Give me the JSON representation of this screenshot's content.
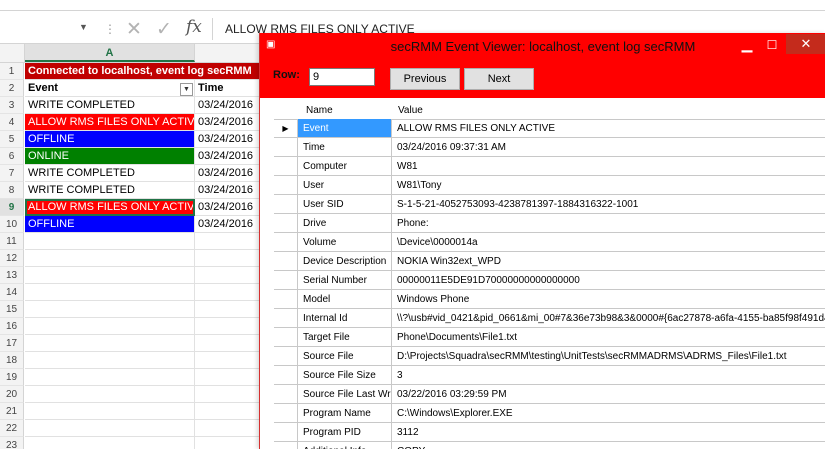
{
  "formula_bar": {
    "value": "ALLOW RMS FILES ONLY ACTIVE",
    "fx": "fx",
    "cancel_glyph": "✕",
    "enter_glyph": "✓"
  },
  "sheet": {
    "column_a": "A",
    "rows": [
      {
        "num": "1",
        "a": "Connected to localhost, event log secRMM",
        "b": "",
        "style": "banner"
      },
      {
        "num": "2",
        "a": "Event",
        "b": "Time",
        "style": "header"
      },
      {
        "num": "3",
        "a": "WRITE COMPLETED",
        "b": "03/24/2016",
        "style": "plain"
      },
      {
        "num": "4",
        "a": "ALLOW RMS FILES ONLY ACTIVE",
        "b": "03/24/2016",
        "style": "red"
      },
      {
        "num": "5",
        "a": "OFFLINE",
        "b": "03/24/2016",
        "style": "blue"
      },
      {
        "num": "6",
        "a": "ONLINE",
        "b": "03/24/2016",
        "style": "green"
      },
      {
        "num": "7",
        "a": "WRITE COMPLETED",
        "b": "03/24/2016",
        "style": "plain"
      },
      {
        "num": "8",
        "a": "WRITE COMPLETED",
        "b": "03/24/2016",
        "style": "plain"
      },
      {
        "num": "9",
        "a": "ALLOW RMS FILES ONLY ACTIVE",
        "b": "03/24/2016",
        "style": "red-selected"
      },
      {
        "num": "10",
        "a": "OFFLINE",
        "b": "03/24/2016",
        "style": "blue"
      },
      {
        "num": "11",
        "a": "",
        "b": "",
        "style": "plain"
      },
      {
        "num": "12",
        "a": "",
        "b": "",
        "style": "plain"
      },
      {
        "num": "13",
        "a": "",
        "b": "",
        "style": "plain"
      },
      {
        "num": "14",
        "a": "",
        "b": "",
        "style": "plain"
      },
      {
        "num": "15",
        "a": "",
        "b": "",
        "style": "plain"
      },
      {
        "num": "16",
        "a": "",
        "b": "",
        "style": "plain"
      },
      {
        "num": "17",
        "a": "",
        "b": "",
        "style": "plain"
      },
      {
        "num": "18",
        "a": "",
        "b": "",
        "style": "plain"
      },
      {
        "num": "19",
        "a": "",
        "b": "",
        "style": "plain"
      },
      {
        "num": "20",
        "a": "",
        "b": "",
        "style": "plain"
      },
      {
        "num": "21",
        "a": "",
        "b": "",
        "style": "plain"
      },
      {
        "num": "22",
        "a": "",
        "b": "",
        "style": "plain"
      },
      {
        "num": "23",
        "a": "",
        "b": "",
        "style": "plain"
      }
    ]
  },
  "viewer": {
    "title": "secRMM Event Viewer: localhost, event log secRMM",
    "row_label": "Row:",
    "row_value": "9",
    "previous_label": "Previous",
    "next_label": "Next",
    "col_name": "Name",
    "col_value": "Value",
    "rows": [
      {
        "name": "Event",
        "value": "ALLOW RMS FILES ONLY ACTIVE"
      },
      {
        "name": "Time",
        "value": "03/24/2016 09:37:31 AM"
      },
      {
        "name": "Computer",
        "value": "W81"
      },
      {
        "name": "User",
        "value": "W81\\Tony"
      },
      {
        "name": "User SID",
        "value": "S-1-5-21-4052753093-4238781397-1884316322-1001"
      },
      {
        "name": "Drive",
        "value": "Phone:"
      },
      {
        "name": "Volume",
        "value": "\\Device\\0000014a"
      },
      {
        "name": "Device Description",
        "value": "NOKIA Win32ext_WPD"
      },
      {
        "name": "Serial Number",
        "value": "00000011E5DE91D70000000000000000"
      },
      {
        "name": "Model",
        "value": "Windows Phone"
      },
      {
        "name": "Internal Id",
        "value": "\\\\?\\usb#vid_0421&pid_0661&mi_00#7&36e73b98&3&0000#{6ac27878-a6fa-4155-ba85f98f491d4f33}"
      },
      {
        "name": "Target File",
        "value": "Phone\\Documents\\File1.txt"
      },
      {
        "name": "Source File",
        "value": "D:\\Projects\\Squadra\\secRMM\\testing\\UnitTests\\secRMMADRMS\\ADRMS_Files\\File1.txt"
      },
      {
        "name": "Source File Size",
        "value": "3"
      },
      {
        "name": "Source File Last Write",
        "value": "03/22/2016 03:29:59 PM"
      },
      {
        "name": "Program Name",
        "value": "C:\\Windows\\Explorer.EXE"
      },
      {
        "name": "Program PID",
        "value": "3112"
      },
      {
        "name": "Additional Info",
        "value": "COPY"
      }
    ]
  }
}
